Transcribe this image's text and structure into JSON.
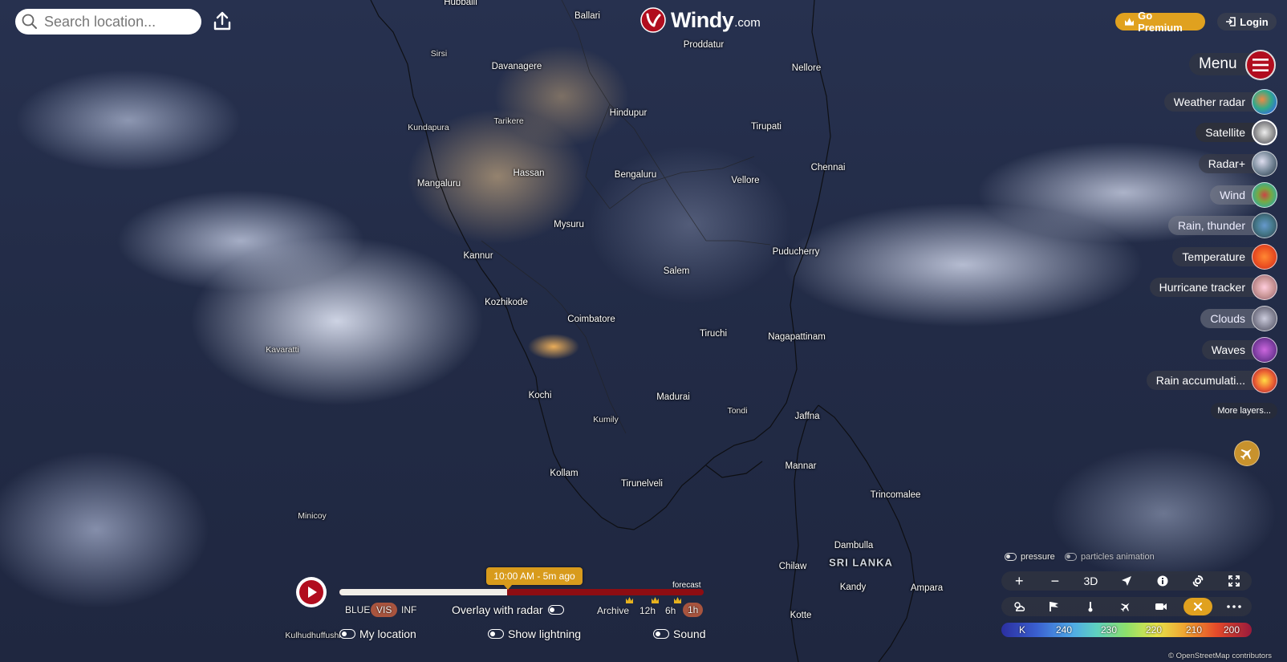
{
  "search": {
    "placeholder": "Search location..."
  },
  "logo": {
    "name": "Windy",
    "suffix": ".com"
  },
  "header": {
    "premium_label": "Go Premium",
    "login_label": "Login",
    "menu_label": "Menu"
  },
  "layers": [
    {
      "label": "Weather radar",
      "icon": "weather-radar-thumb",
      "state": "normal"
    },
    {
      "label": "Satellite",
      "icon": "satellite-thumb",
      "state": "active"
    },
    {
      "label": "Radar+",
      "icon": "radar-plus-thumb",
      "state": "normal"
    },
    {
      "label": "Wind",
      "icon": "wind-thumb",
      "state": "faded"
    },
    {
      "label": "Rain, thunder",
      "icon": "rain-thunder-thumb",
      "state": "faded"
    },
    {
      "label": "Temperature",
      "icon": "temperature-thumb",
      "state": "normal"
    },
    {
      "label": "Hurricane tracker",
      "icon": "hurricane-thumb",
      "state": "normal"
    },
    {
      "label": "Clouds",
      "icon": "clouds-thumb",
      "state": "faded"
    },
    {
      "label": "Waves",
      "icon": "waves-thumb",
      "state": "normal"
    },
    {
      "label": "Rain accumulati...",
      "icon": "rain-accumulation-thumb",
      "state": "normal"
    }
  ],
  "more_layers_label": "More layers...",
  "overlays": {
    "pressure_label": "pressure",
    "particles_label": "particles animation"
  },
  "toolbar1": {
    "zoom_in": "+",
    "zoom_out": "−",
    "three_d": "3D"
  },
  "color_scale": {
    "unit": "K",
    "ticks": [
      "240",
      "230",
      "220",
      "210",
      "200"
    ]
  },
  "credit": "© OpenStreetMap contributors",
  "timeline": {
    "time_label": "10:00 AM - 5m ago",
    "forecast_label": "forecast",
    "progress": 0.46,
    "bands": [
      "BLUE",
      "VIS",
      "INF"
    ],
    "selected_band": "VIS",
    "overlay_label": "Overlay with radar",
    "intervals": [
      "Archive",
      "12h",
      "6h",
      "1h"
    ],
    "selected_interval": "1h"
  },
  "bottom_toggles": {
    "my_location": "My location",
    "lightning": "Show lightning",
    "sound": "Sound"
  },
  "cities": [
    "Hubballi",
    "Ballari",
    "Proddatur",
    "Sirsi",
    "Davanagere",
    "Nellore",
    "Kundapura",
    "Tarikere",
    "Hindupur",
    "Tirupati",
    "Hassan",
    "Bengaluru",
    "Mangaluru",
    "Vellore",
    "Chennai",
    "Mysuru",
    "Kannur",
    "Puducherry",
    "Salem",
    "Kozhikode",
    "Coimbatore",
    "Tiruchi",
    "Nagapattinam",
    "Kavaratti",
    "Kochi",
    "Madurai",
    "Kumily",
    "Tondi",
    "Jaffna",
    "Mannar",
    "Kollam",
    "Tirunelveli",
    "Trincomalee",
    "Minicoy",
    "Dambulla",
    "SRI LANKA",
    "Chilaw",
    "Kandy",
    "Ampara",
    "Kotte",
    "Kulhudhuffushi"
  ],
  "colors": {
    "brand_red": "#b10d1e",
    "premium_gold": "#e0a11f",
    "timeline_red": "#8e0d12"
  }
}
